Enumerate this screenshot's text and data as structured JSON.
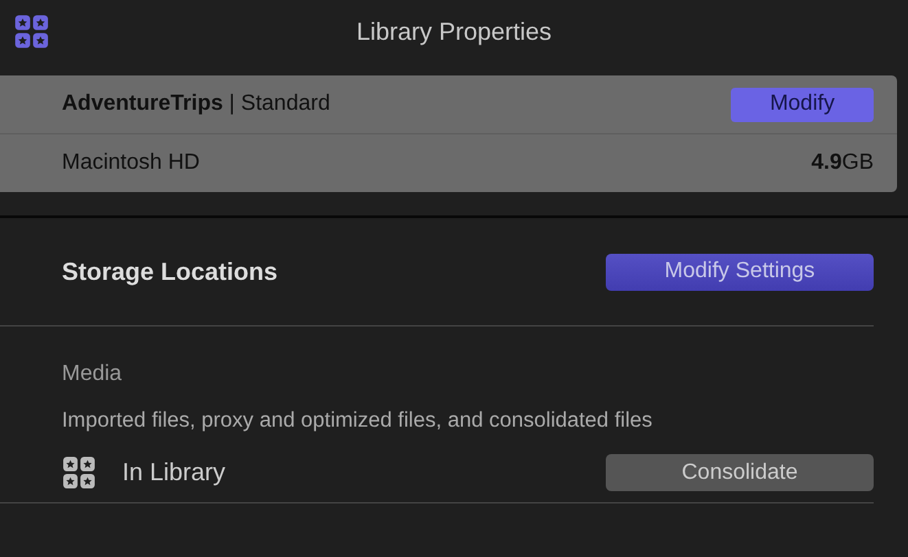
{
  "window": {
    "title": "Library Properties"
  },
  "library": {
    "name": "**AdventureTrips** | Standard",
    "modify_button": "Modify",
    "disk": "Macintosh HD",
    "size": "**4.9**GB"
  },
  "storage": {
    "heading": "Storage Locations",
    "button": "Modify Settings"
  },
  "media": {
    "label": "Media",
    "description": "Imported files, proxy and optimized files, and consolidated files",
    "location": "In Library",
    "button": "Consolidate"
  }
}
